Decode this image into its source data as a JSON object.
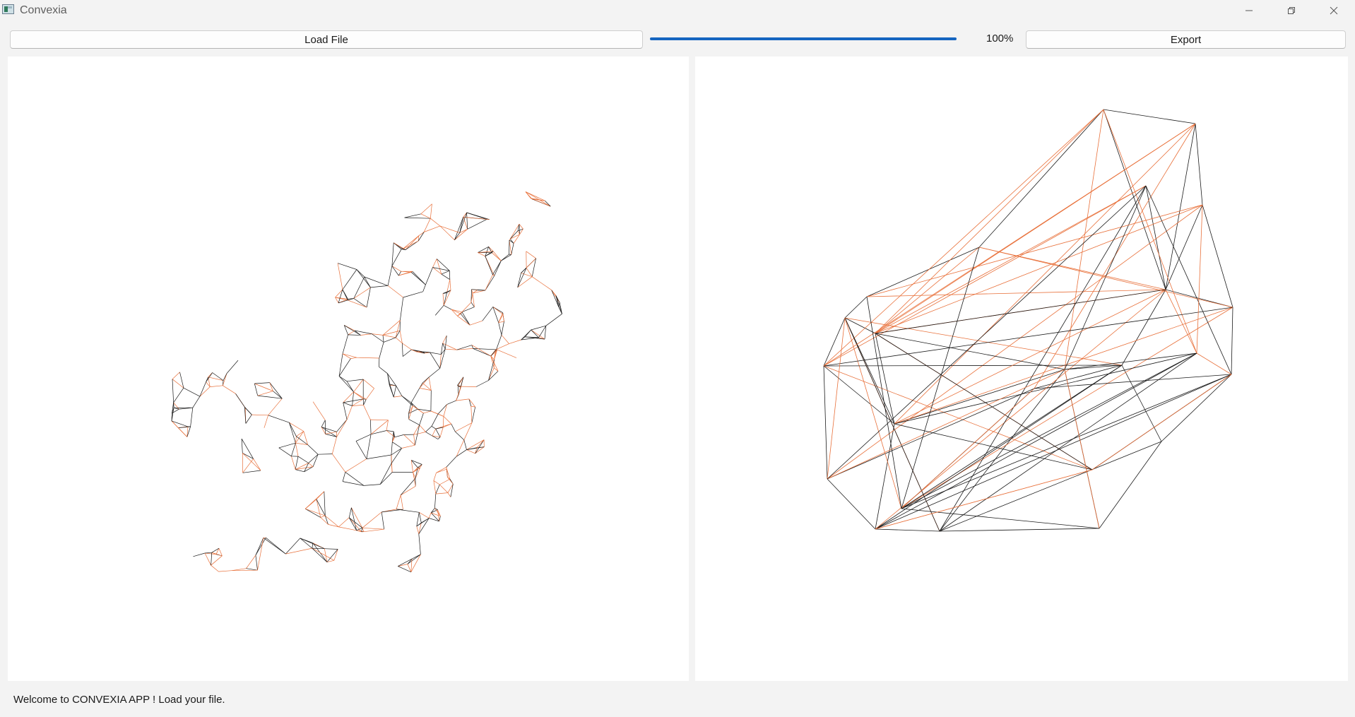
{
  "window": {
    "title": "Convexia",
    "icons": [
      "app-icon",
      "minimize-icon",
      "restore-icon",
      "close-icon"
    ]
  },
  "toolbar": {
    "load_label": "Load File",
    "export_label": "Export",
    "progress_value": 1.0,
    "progress_text": "100%"
  },
  "viewports": {
    "left": {
      "content": "wireframe dragon mesh"
    },
    "right": {
      "content": "wireframe convex hull"
    }
  },
  "status": {
    "message": "Welcome to CONVEXIA APP ! Load your file."
  },
  "colors": {
    "accent": "#1565c0",
    "mesh_orange": "#e8703a",
    "mesh_black": "#1a1a1a",
    "background": "#f3f3f3",
    "viewport": "#ffffff"
  }
}
